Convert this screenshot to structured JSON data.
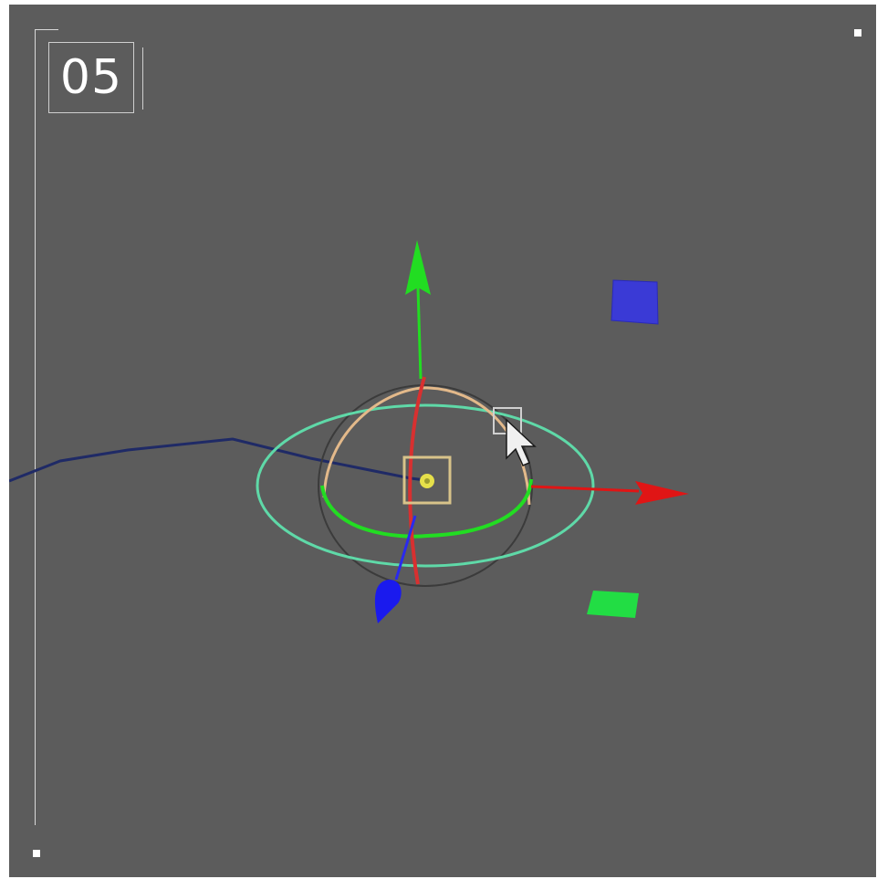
{
  "step": {
    "number": "05"
  },
  "viewport": {
    "background": "#5c5c5c"
  },
  "gizmo": {
    "axis_colors": {
      "x": "#e01515",
      "y": "#22dd22",
      "z": "#1a1aee"
    },
    "ring_color": "#5fd9a8",
    "arc_color": "#e3b98a",
    "handle_color": "#d8c38a",
    "pivot_color": "#e6e04a"
  },
  "icons": {
    "cursor": "arrow-cursor-icon"
  }
}
